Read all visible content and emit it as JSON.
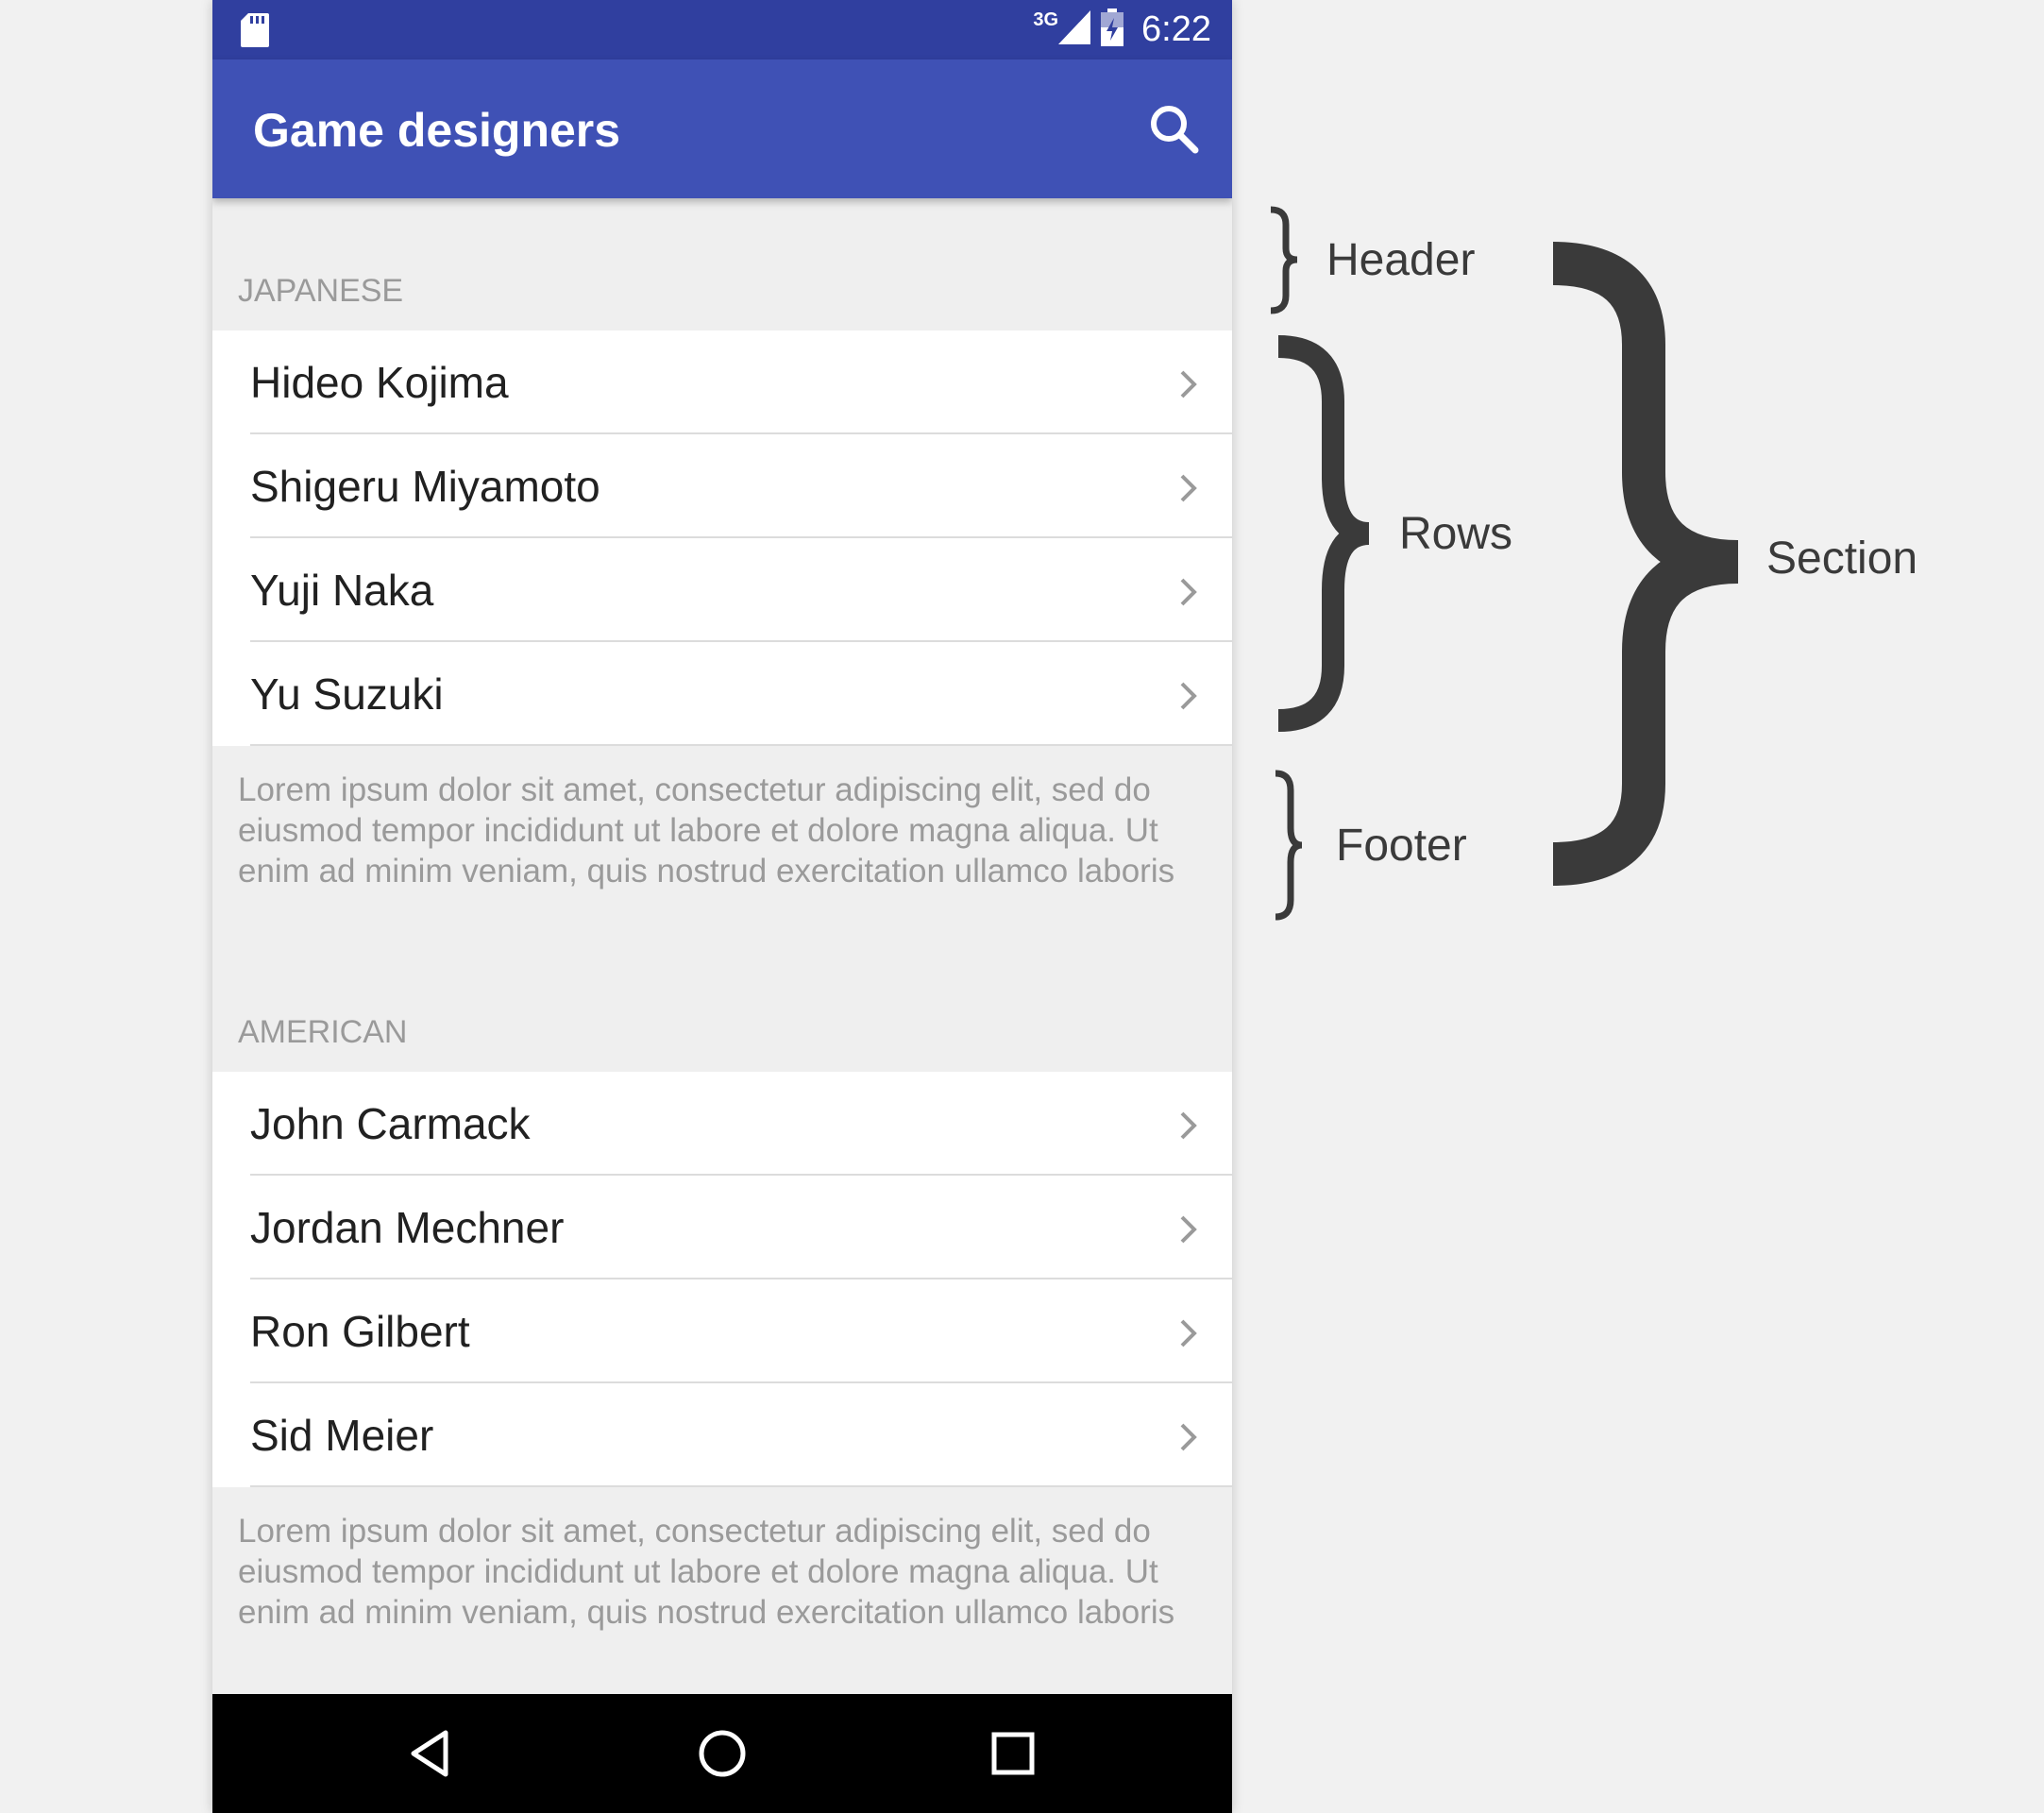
{
  "status_bar": {
    "network": "3G",
    "time": "6:22"
  },
  "app_bar": {
    "title": "Game designers",
    "search_icon": "search-icon"
  },
  "sections": [
    {
      "header": "JAPANESE",
      "rows": [
        "Hideo Kojima",
        "Shigeru Miyamoto",
        "Yuji Naka",
        "Yu Suzuki"
      ],
      "footer": "Lorem ipsum dolor sit amet, consectetur adipiscing elit, sed do eiusmod tempor incididunt ut labore et dolore magna aliqua. Ut enim ad minim veniam, quis nostrud exercitation ullamco laboris"
    },
    {
      "header": "AMERICAN",
      "rows": [
        "John Carmack",
        "Jordan Mechner",
        "Ron Gilbert",
        "Sid Meier"
      ],
      "footer": "Lorem ipsum dolor sit amet, consectetur adipiscing elit, sed do eiusmod tempor incididunt ut labore et dolore magna aliqua. Ut enim ad minim veniam, quis nostrud exercitation ullamco laboris"
    }
  ],
  "annotations": {
    "header": "Header",
    "rows": "Rows",
    "footer": "Footer",
    "section": "Section"
  },
  "colors": {
    "status_bar": "#303f9f",
    "app_bar": "#3f51b5",
    "annotation": "#3a3a3a"
  }
}
